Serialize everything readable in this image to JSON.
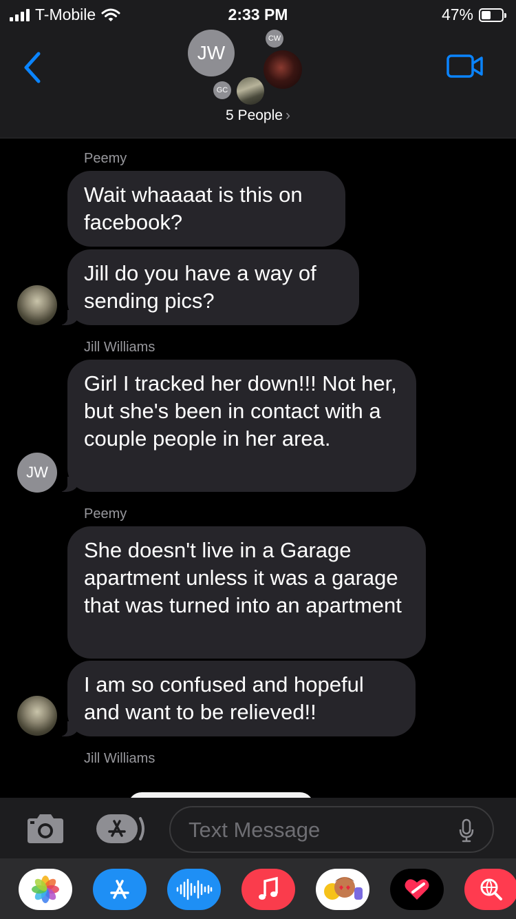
{
  "status_bar": {
    "carrier": "T-Mobile",
    "time": "2:33 PM",
    "battery": "47%",
    "battery_level": 0.47
  },
  "header": {
    "group_initials": "JW",
    "member_initials_1": "CW",
    "member_initials_2": "GC",
    "people_label": "5 People",
    "people_chevron": "›",
    "accent_color": "#0a84ff"
  },
  "messages": [
    {
      "sender": "Peemy",
      "text": "Wait whaaaat is this on facebook?"
    },
    {
      "text": "Jill do you have a way of sending pics?"
    },
    {
      "sender": "Jill Williams",
      "avatar_initials": "JW",
      "text": "Girl I tracked her down!!! Not her, but she's been in contact with a couple people in her area."
    },
    {
      "sender": "Peemy",
      "text": "She doesn't live in a Garage apartment unless it was a garage that was turned into an apartment"
    },
    {
      "text": "I am so confused and hopeful and want to be relieved!!"
    },
    {
      "sender": "Jill Williams"
    }
  ],
  "input_bar": {
    "placeholder": "Text Message",
    "icons": [
      "camera-icon",
      "app-store-icon",
      "microphone-icon"
    ]
  },
  "app_drawer": {
    "apps": [
      "photos-icon",
      "app-store-icon",
      "audio-messages-icon",
      "music-icon",
      "memoji-icon",
      "digital-touch-icon",
      "web-images-icon"
    ]
  }
}
